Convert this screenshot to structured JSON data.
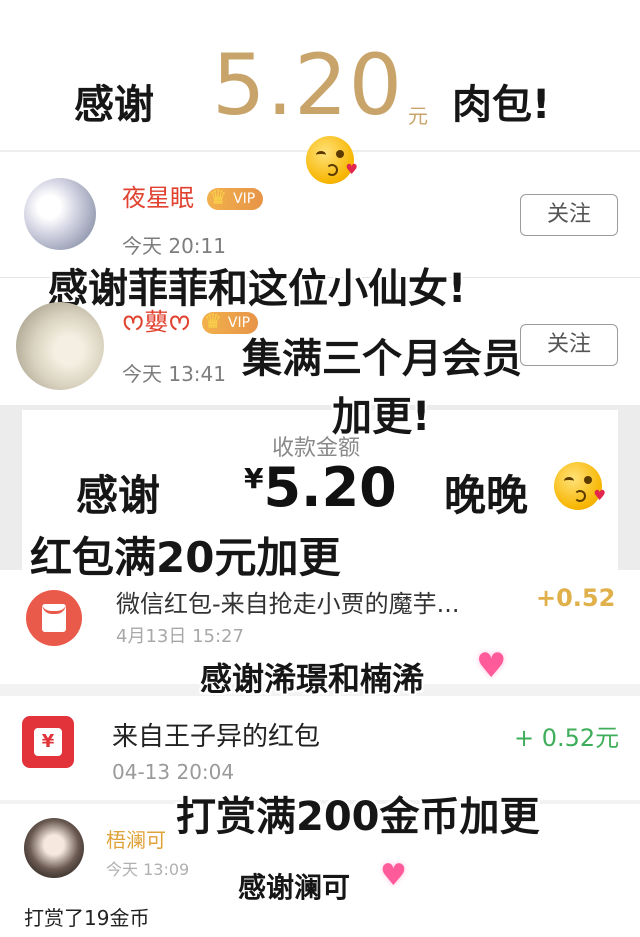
{
  "top": {
    "thanks": "感谢",
    "amount": "5.20",
    "unit": "元",
    "item": "肉包!",
    "emoji": "kiss-emoji"
  },
  "feed": {
    "post1": {
      "username": "夜星眠",
      "vip": "VIP",
      "time": "今天 20:11",
      "follow": "关注"
    },
    "post2": {
      "username": "ᰔ蘡ᰔ",
      "vip": "VIP",
      "time": "今天 13:41",
      "follow": "关注"
    }
  },
  "overlays": {
    "thanks_fairy": "感谢菲菲和这位小仙女!",
    "three_month": "集满三个月会员",
    "add_more": "加更!",
    "thanks2": "感谢",
    "wanwan": "晚晚",
    "redpack_goal": "红包满20元加更",
    "thanks_xi": "感谢浠璟和楠浠",
    "gold_goal": "打赏满200金币加更",
    "thanks_lanke": "感谢澜可"
  },
  "receipt": {
    "label": "收款金额",
    "currency": "¥",
    "amount": "5.20"
  },
  "tx1": {
    "title": "微信红包-来自抢走小贾的魔芋...",
    "time": "4月13日 15:27",
    "amount": "+0.52"
  },
  "tx2": {
    "title": "来自王子异的红包",
    "time": "04-13 20:04",
    "amount": "+ 0.52元"
  },
  "reward": {
    "username": "梧澜可",
    "time": "今天 13:09",
    "text": "打赏了19金币"
  },
  "colors": {
    "gold": "#c8a46a",
    "red": "#e0422f",
    "green": "#4caf50"
  }
}
